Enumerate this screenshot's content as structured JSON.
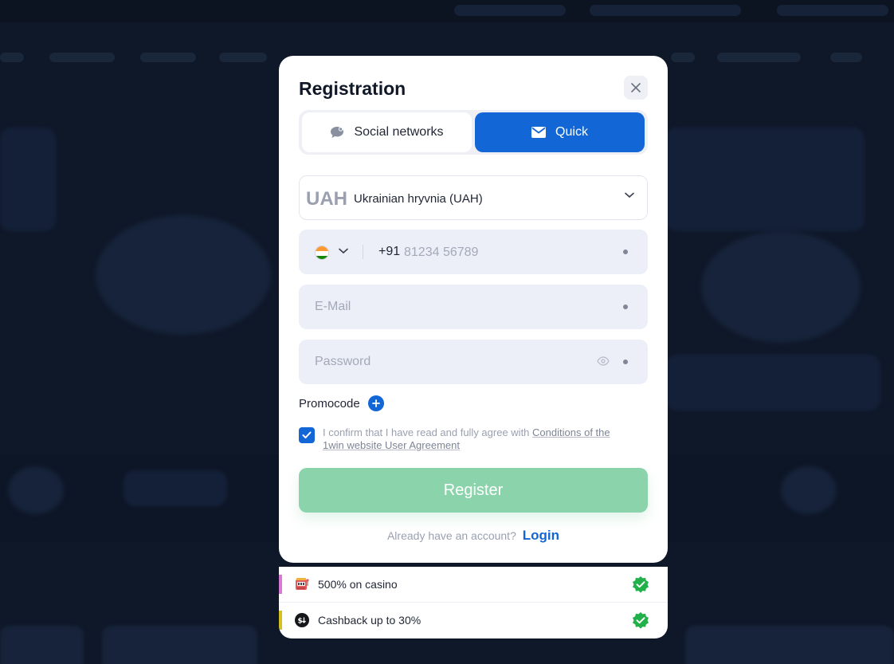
{
  "registration": {
    "title": "Registration",
    "tabs": [
      {
        "label": "Social networks",
        "icon": "chat-bubble-icon",
        "active": false
      },
      {
        "label": "Quick",
        "icon": "envelope-icon",
        "active": true
      }
    ],
    "currency": {
      "code": "UAH",
      "name": "Ukrainian hryvnia (UAH)"
    },
    "phone": {
      "country": "India",
      "dial_code": "+91",
      "placeholder": "81234 56789"
    },
    "email": {
      "placeholder": "E-Mail"
    },
    "password": {
      "placeholder": "Password"
    },
    "promocode_label": "Promocode",
    "agreement": {
      "checked": true,
      "text": "I confirm that I have read and fully agree with",
      "link_text": "Conditions of the 1win website User Agreement"
    },
    "register_button": "Register",
    "login_prompt": "Already have an account?",
    "login_link": "Login"
  },
  "bonuses": [
    {
      "label": "500% on casino",
      "accent": "#d67ad6",
      "icon": "slot-machine-icon"
    },
    {
      "label": "Cashback up to 30%",
      "accent": "#d6c020",
      "icon": "cashback-icon"
    }
  ],
  "colors": {
    "primary": "#1266d6",
    "register_bg": "#8bd3ab",
    "check_green": "#22b04a",
    "backdrop": "#0f1829"
  }
}
